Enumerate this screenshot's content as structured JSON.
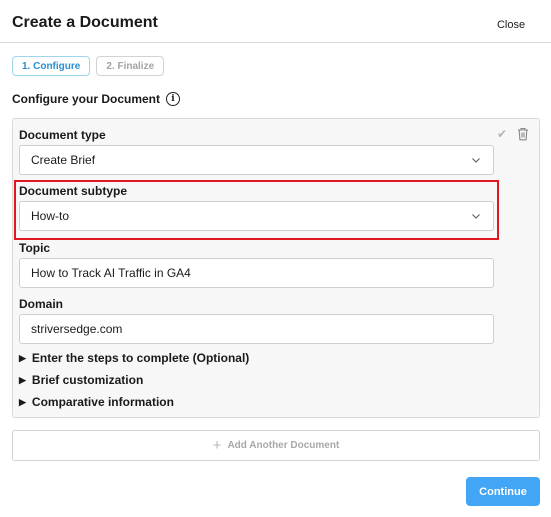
{
  "header": {
    "title": "Create a Document",
    "close_label": "Close"
  },
  "steps": [
    {
      "label": "1. Configure",
      "active": true
    },
    {
      "label": "2. Finalize",
      "active": false
    }
  ],
  "section": {
    "title": "Configure your Document",
    "info_icon": "info-icon"
  },
  "card": {
    "icons": [
      "check-icon",
      "trash-icon"
    ],
    "document_type": {
      "label": "Document type",
      "value": "Create Brief"
    },
    "document_subtype": {
      "label": "Document subtype",
      "value": "How-to"
    },
    "topic": {
      "label": "Topic",
      "value": "How to Track AI Traffic in GA4"
    },
    "domain": {
      "label": "Domain",
      "value": "striversedge.com"
    },
    "expanders": [
      "Enter the steps to complete (Optional)",
      "Brief customization",
      "Comparative information"
    ]
  },
  "add_document": {
    "label": "Add Another Document",
    "icon": "plus-icon"
  },
  "footer": {
    "continue_label": "Continue"
  },
  "colors": {
    "accent": "#42a5f5",
    "highlight": "#e0171f",
    "step_active": "#2a8fd1"
  }
}
